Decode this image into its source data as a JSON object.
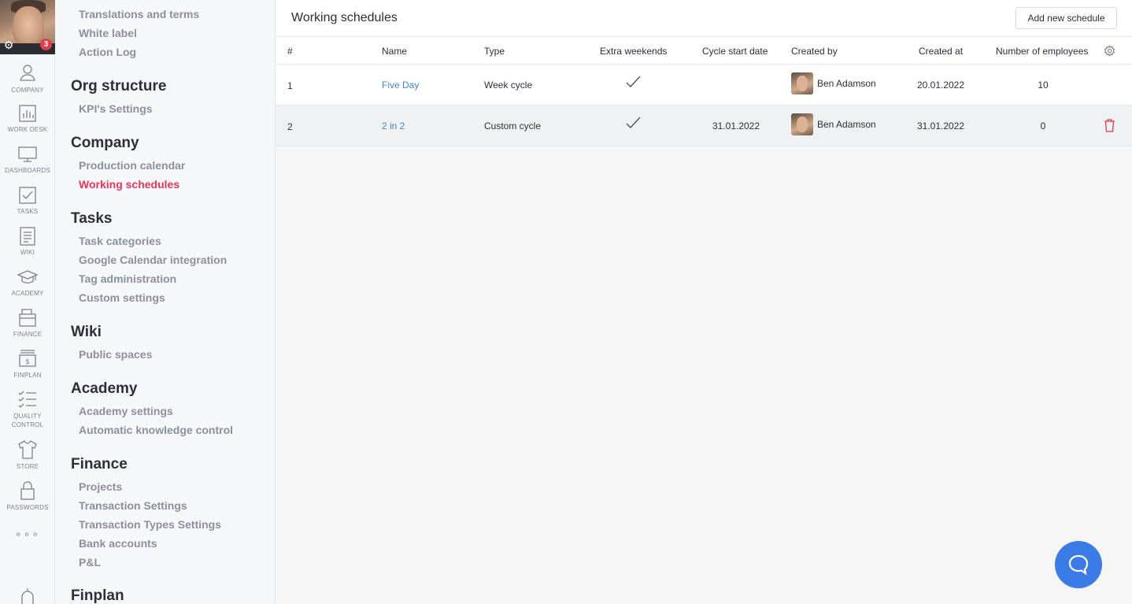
{
  "user": {
    "notifications": "3"
  },
  "rail": [
    {
      "label": "COMPANY",
      "icon": "company-icon"
    },
    {
      "label": "WORK DESK",
      "icon": "workdesk-icon"
    },
    {
      "label": "DASHBOARDS",
      "icon": "monitor-icon"
    },
    {
      "label": "TASKS",
      "icon": "checkbox-icon"
    },
    {
      "label": "WIKI",
      "icon": "document-icon"
    },
    {
      "label": "ACADEMY",
      "icon": "graduation-cap-icon"
    },
    {
      "label": "FINANCE",
      "icon": "wallet-icon"
    },
    {
      "label": "FINPLAN",
      "icon": "money-icon"
    },
    {
      "label": "QUALITY",
      "label2": "CONTROL",
      "icon": "checklist-icon"
    },
    {
      "label": "STORE",
      "icon": "tshirt-icon"
    },
    {
      "label": "PASSWORDS",
      "icon": "lock-icon"
    }
  ],
  "rail_more": "∘∘∘",
  "sidebar": {
    "top_links": [
      "Translations and terms",
      "White label",
      "Action Log"
    ],
    "org_structure": {
      "title": "Org structure",
      "links": [
        "KPI's Settings"
      ]
    },
    "company": {
      "title": "Company",
      "links": [
        "Production calendar",
        "Working schedules"
      ]
    },
    "tasks": {
      "title": "Tasks",
      "links": [
        "Task categories",
        "Google Calendar integration",
        "Tag administration",
        "Custom settings"
      ]
    },
    "wiki": {
      "title": "Wiki",
      "links": [
        "Public spaces"
      ]
    },
    "academy": {
      "title": "Academy",
      "links": [
        "Academy settings",
        "Automatic knowledge control"
      ]
    },
    "finance": {
      "title": "Finance",
      "links": [
        "Projects",
        "Transaction Settings",
        "Transaction Types Settings",
        "Bank accounts",
        "P&L"
      ]
    },
    "finplan": {
      "title": "Finplan"
    }
  },
  "header": {
    "title": "Working schedules",
    "add_button": "Add new schedule"
  },
  "table": {
    "columns": [
      "#",
      "Name",
      "Type",
      "Extra weekends",
      "Cycle start date",
      "Created by",
      "Created at",
      "Number of employees"
    ],
    "rows": [
      {
        "num": "1",
        "name": "Five Day",
        "type": "Week cycle",
        "extra_weekends": true,
        "cycle_start": "",
        "created_by": "Ben Adamson",
        "created_at": "20.01.2022",
        "employees": "10"
      },
      {
        "num": "2",
        "name": "2 in 2",
        "type": "Custom cycle",
        "extra_weekends": true,
        "cycle_start": "31.01.2022",
        "created_by": "Ben Adamson",
        "created_at": "31.01.2022",
        "employees": "0"
      }
    ]
  },
  "colors": {
    "accent_active": "#e8345a",
    "link": "#3d88c9",
    "chat_button": "#3a7be6",
    "delete": "#e33b4a"
  }
}
